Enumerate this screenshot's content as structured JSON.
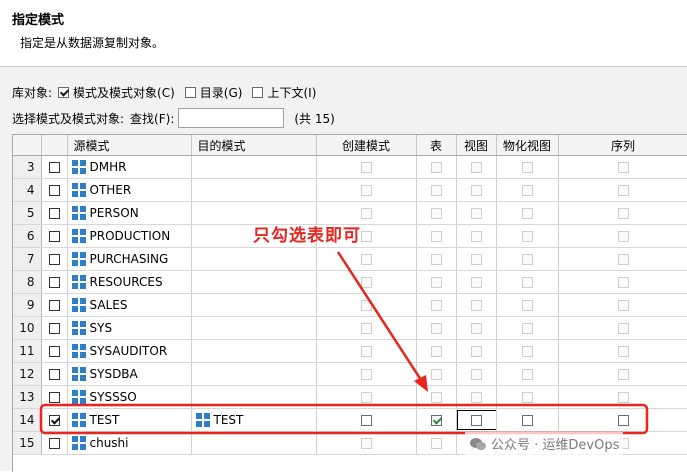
{
  "header": {
    "title": "指定模式",
    "description": "指定是从数据源复制对象。"
  },
  "options": {
    "scope_label": "库对象:",
    "checkboxes": [
      {
        "label": "模式及模式对象(C)",
        "checked": true
      },
      {
        "label": "目录(G)",
        "checked": false
      },
      {
        "label": "上下文(I)",
        "checked": false
      }
    ],
    "select_label": "选择模式及模式对象:",
    "search_label": "查找(F):",
    "search_value": "",
    "count_text": "(共 15)"
  },
  "grid": {
    "columns": [
      "",
      "",
      "源模式",
      "目的模式",
      "创建模式",
      "表",
      "视图",
      "物化视图",
      "序列"
    ],
    "rows": [
      {
        "num": "3",
        "selected": false,
        "source": "DMHR",
        "target": "",
        "create": "disabled",
        "table": "disabled",
        "view": "disabled",
        "mview": "disabled",
        "seq": "disabled"
      },
      {
        "num": "4",
        "selected": false,
        "source": "OTHER",
        "target": "",
        "create": "disabled",
        "table": "disabled",
        "view": "disabled",
        "mview": "disabled",
        "seq": "disabled"
      },
      {
        "num": "5",
        "selected": false,
        "source": "PERSON",
        "target": "",
        "create": "disabled",
        "table": "disabled",
        "view": "disabled",
        "mview": "disabled",
        "seq": "disabled"
      },
      {
        "num": "6",
        "selected": false,
        "source": "PRODUCTION",
        "target": "",
        "create": "disabled",
        "table": "disabled",
        "view": "disabled",
        "mview": "disabled",
        "seq": "disabled"
      },
      {
        "num": "7",
        "selected": false,
        "source": "PURCHASING",
        "target": "",
        "create": "disabled",
        "table": "disabled",
        "view": "disabled",
        "mview": "disabled",
        "seq": "disabled"
      },
      {
        "num": "8",
        "selected": false,
        "source": "RESOURCES",
        "target": "",
        "create": "disabled",
        "table": "disabled",
        "view": "disabled",
        "mview": "disabled",
        "seq": "disabled"
      },
      {
        "num": "9",
        "selected": false,
        "source": "SALES",
        "target": "",
        "create": "disabled",
        "table": "disabled",
        "view": "disabled",
        "mview": "disabled",
        "seq": "disabled"
      },
      {
        "num": "10",
        "selected": false,
        "source": "SYS",
        "target": "",
        "create": "disabled",
        "table": "disabled",
        "view": "disabled",
        "mview": "disabled",
        "seq": "disabled"
      },
      {
        "num": "11",
        "selected": false,
        "source": "SYSAUDITOR",
        "target": "",
        "create": "disabled",
        "table": "disabled",
        "view": "disabled",
        "mview": "disabled",
        "seq": "disabled"
      },
      {
        "num": "12",
        "selected": false,
        "source": "SYSDBA",
        "target": "",
        "create": "disabled",
        "table": "disabled",
        "view": "disabled",
        "mview": "disabled",
        "seq": "disabled"
      },
      {
        "num": "13",
        "selected": false,
        "source": "SYSSSO",
        "target": "",
        "create": "disabled",
        "table": "disabled",
        "view": "disabled",
        "mview": "disabled",
        "seq": "disabled"
      },
      {
        "num": "14",
        "selected": true,
        "source": "TEST",
        "target": "TEST",
        "create": "unchecked",
        "table": "checked",
        "view": "unchecked",
        "mview": "unchecked",
        "seq": "unchecked"
      },
      {
        "num": "15",
        "selected": false,
        "source": "chushi",
        "target": "",
        "create": "disabled",
        "table": "disabled",
        "view": "disabled",
        "mview": "disabled",
        "seq": "disabled"
      }
    ]
  },
  "annotation": {
    "text": "只勾选表即可",
    "color": "#e8251e"
  },
  "watermark": {
    "text": "公众号 · 运维DevOps"
  },
  "colors": {
    "schema_icon": "#2f7fc4",
    "check_green": "#2a8a2a"
  }
}
